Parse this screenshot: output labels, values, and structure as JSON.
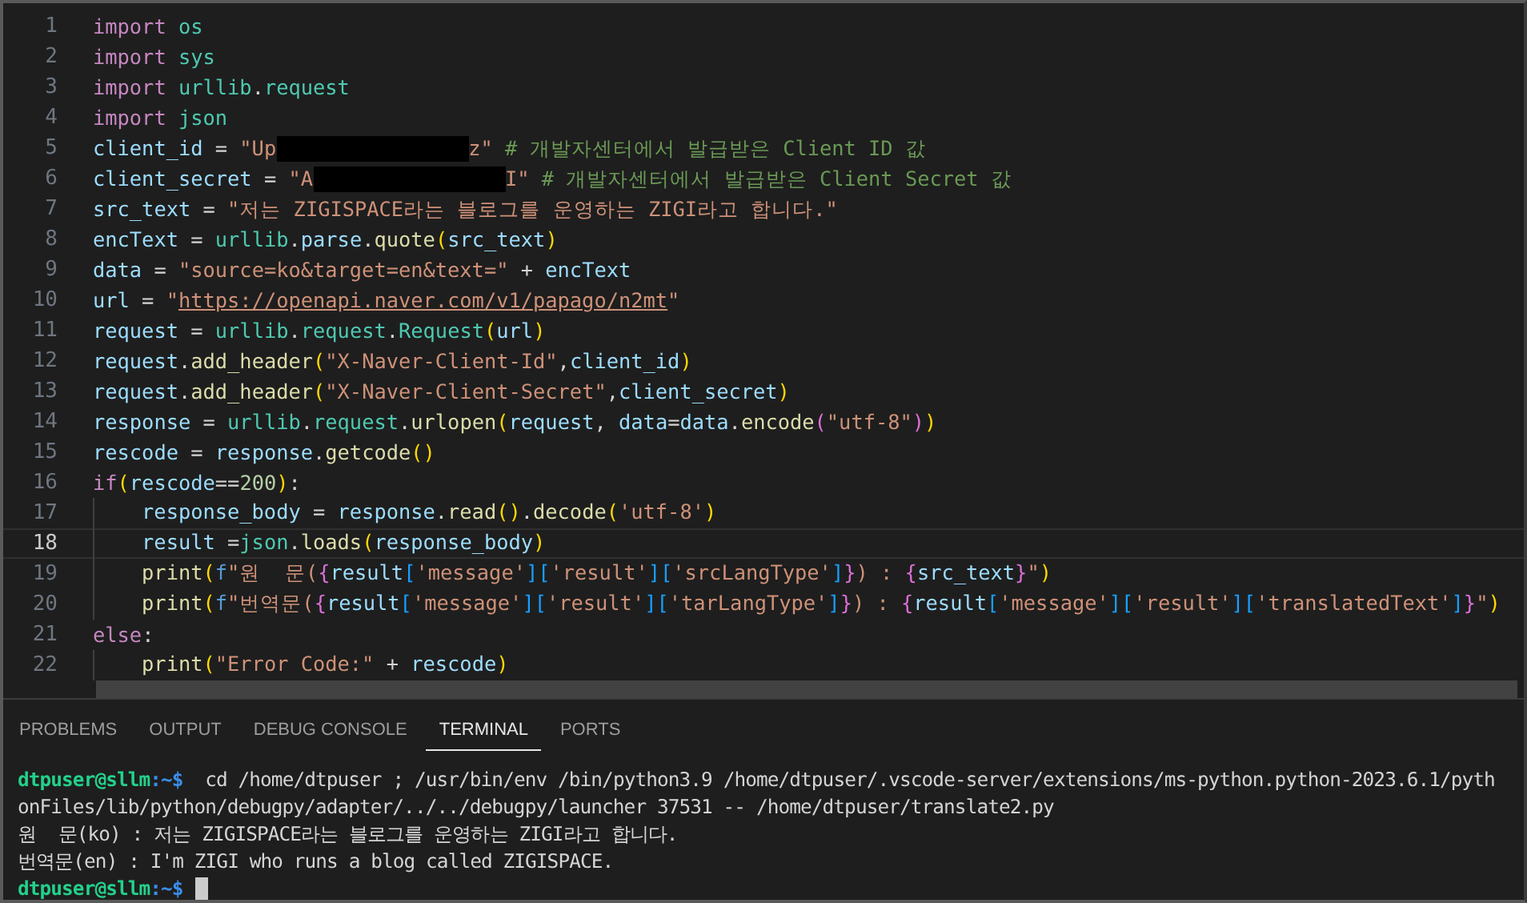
{
  "editor": {
    "lines": [
      {
        "number": "1",
        "current": false,
        "tokens": [
          {
            "kind": "keyword",
            "text": "import"
          },
          {
            "kind": "module",
            "text": " os"
          }
        ]
      },
      {
        "number": "2",
        "current": false,
        "tokens": [
          {
            "kind": "keyword",
            "text": "import"
          },
          {
            "kind": "module",
            "text": " sys"
          }
        ]
      },
      {
        "number": "3",
        "current": false,
        "tokens": [
          {
            "kind": "keyword",
            "text": "import"
          },
          {
            "kind": "module",
            "text": " urllib"
          },
          {
            "kind": "plain",
            "text": "."
          },
          {
            "kind": "module",
            "text": "request"
          }
        ]
      },
      {
        "number": "4",
        "current": false,
        "tokens": [
          {
            "kind": "keyword",
            "text": "import"
          },
          {
            "kind": "module",
            "text": " json"
          }
        ]
      },
      {
        "number": "5",
        "current": false,
        "tokens": [
          {
            "kind": "variable",
            "text": "client_id"
          },
          {
            "kind": "plain",
            "text": " = "
          },
          {
            "kind": "string",
            "text": "\"Up"
          },
          {
            "kind": "redacted"
          },
          {
            "kind": "string",
            "text": "z\""
          },
          {
            "kind": "comment",
            "text": " # 개발자센터에서 발급받은 Client ID 값"
          }
        ]
      },
      {
        "number": "6",
        "current": false,
        "tokens": [
          {
            "kind": "variable",
            "text": "client_secret"
          },
          {
            "kind": "plain",
            "text": " = "
          },
          {
            "kind": "string",
            "text": "\"A"
          },
          {
            "kind": "redacted"
          },
          {
            "kind": "string",
            "text": "I\""
          },
          {
            "kind": "comment",
            "text": " # 개발자센터에서 발급받은 Client Secret 값"
          }
        ]
      },
      {
        "number": "7",
        "current": false,
        "tokens": [
          {
            "kind": "variable",
            "text": "src_text"
          },
          {
            "kind": "plain",
            "text": " = "
          },
          {
            "kind": "string",
            "text": "\"저는 ZIGISPACE라는 블로그를 운영하는 ZIGI라고 합니다.\""
          }
        ]
      },
      {
        "number": "8",
        "current": false,
        "tokens": [
          {
            "kind": "variable",
            "text": "encText"
          },
          {
            "kind": "plain",
            "text": " = "
          },
          {
            "kind": "module",
            "text": "urllib"
          },
          {
            "kind": "plain",
            "text": "."
          },
          {
            "kind": "variable",
            "text": "parse"
          },
          {
            "kind": "plain",
            "text": "."
          },
          {
            "kind": "function",
            "text": "quote"
          },
          {
            "kind": "paren",
            "text": "("
          },
          {
            "kind": "variable",
            "text": "src_text"
          },
          {
            "kind": "paren",
            "text": ")"
          }
        ]
      },
      {
        "number": "9",
        "current": false,
        "tokens": [
          {
            "kind": "variable",
            "text": "data"
          },
          {
            "kind": "plain",
            "text": " = "
          },
          {
            "kind": "string",
            "text": "\"source=ko&target=en&text=\""
          },
          {
            "kind": "plain",
            "text": " + "
          },
          {
            "kind": "variable",
            "text": "encText"
          }
        ]
      },
      {
        "number": "10",
        "current": false,
        "tokens": [
          {
            "kind": "variable",
            "text": "url"
          },
          {
            "kind": "plain",
            "text": " = "
          },
          {
            "kind": "string",
            "text": "\""
          },
          {
            "kind": "link",
            "text": "https://openapi.naver.com/v1/papago/n2mt"
          },
          {
            "kind": "string",
            "text": "\""
          }
        ]
      },
      {
        "number": "11",
        "current": false,
        "tokens": [
          {
            "kind": "variable",
            "text": "request"
          },
          {
            "kind": "plain",
            "text": " = "
          },
          {
            "kind": "module",
            "text": "urllib"
          },
          {
            "kind": "plain",
            "text": "."
          },
          {
            "kind": "module",
            "text": "request"
          },
          {
            "kind": "plain",
            "text": "."
          },
          {
            "kind": "module",
            "text": "Request"
          },
          {
            "kind": "paren",
            "text": "("
          },
          {
            "kind": "variable",
            "text": "url"
          },
          {
            "kind": "paren",
            "text": ")"
          }
        ]
      },
      {
        "number": "12",
        "current": false,
        "tokens": [
          {
            "kind": "variable",
            "text": "request"
          },
          {
            "kind": "plain",
            "text": "."
          },
          {
            "kind": "function",
            "text": "add_header"
          },
          {
            "kind": "paren",
            "text": "("
          },
          {
            "kind": "string",
            "text": "\"X-Naver-Client-Id\""
          },
          {
            "kind": "plain",
            "text": ","
          },
          {
            "kind": "variable",
            "text": "client_id"
          },
          {
            "kind": "paren",
            "text": ")"
          }
        ]
      },
      {
        "number": "13",
        "current": false,
        "tokens": [
          {
            "kind": "variable",
            "text": "request"
          },
          {
            "kind": "plain",
            "text": "."
          },
          {
            "kind": "function",
            "text": "add_header"
          },
          {
            "kind": "paren",
            "text": "("
          },
          {
            "kind": "string",
            "text": "\"X-Naver-Client-Secret\""
          },
          {
            "kind": "plain",
            "text": ","
          },
          {
            "kind": "variable",
            "text": "client_secret"
          },
          {
            "kind": "paren",
            "text": ")"
          }
        ]
      },
      {
        "number": "14",
        "current": false,
        "tokens": [
          {
            "kind": "variable",
            "text": "response"
          },
          {
            "kind": "plain",
            "text": " = "
          },
          {
            "kind": "module",
            "text": "urllib"
          },
          {
            "kind": "plain",
            "text": "."
          },
          {
            "kind": "module",
            "text": "request"
          },
          {
            "kind": "plain",
            "text": "."
          },
          {
            "kind": "function",
            "text": "urlopen"
          },
          {
            "kind": "paren",
            "text": "("
          },
          {
            "kind": "variable",
            "text": "request"
          },
          {
            "kind": "plain",
            "text": ", "
          },
          {
            "kind": "variable",
            "text": "data"
          },
          {
            "kind": "plain",
            "text": "="
          },
          {
            "kind": "variable",
            "text": "data"
          },
          {
            "kind": "plain",
            "text": "."
          },
          {
            "kind": "function",
            "text": "encode"
          },
          {
            "kind": "brace",
            "text": "("
          },
          {
            "kind": "string",
            "text": "\"utf-8\""
          },
          {
            "kind": "brace",
            "text": ")"
          },
          {
            "kind": "paren",
            "text": ")"
          }
        ]
      },
      {
        "number": "15",
        "current": false,
        "tokens": [
          {
            "kind": "variable",
            "text": "rescode"
          },
          {
            "kind": "plain",
            "text": " = "
          },
          {
            "kind": "variable",
            "text": "response"
          },
          {
            "kind": "plain",
            "text": "."
          },
          {
            "kind": "function",
            "text": "getcode"
          },
          {
            "kind": "paren",
            "text": "()"
          }
        ]
      },
      {
        "number": "16",
        "current": false,
        "tokens": [
          {
            "kind": "keyword",
            "text": "if"
          },
          {
            "kind": "paren",
            "text": "("
          },
          {
            "kind": "variable",
            "text": "rescode"
          },
          {
            "kind": "plain",
            "text": "=="
          },
          {
            "kind": "number",
            "text": "200"
          },
          {
            "kind": "paren",
            "text": ")"
          },
          {
            "kind": "plain",
            "text": ":"
          }
        ]
      },
      {
        "number": "17",
        "current": false,
        "tokens": [
          {
            "kind": "indent"
          },
          {
            "kind": "variable",
            "text": "response_body"
          },
          {
            "kind": "plain",
            "text": " = "
          },
          {
            "kind": "variable",
            "text": "response"
          },
          {
            "kind": "plain",
            "text": "."
          },
          {
            "kind": "function",
            "text": "read"
          },
          {
            "kind": "paren",
            "text": "()"
          },
          {
            "kind": "plain",
            "text": "."
          },
          {
            "kind": "function",
            "text": "decode"
          },
          {
            "kind": "paren",
            "text": "("
          },
          {
            "kind": "string",
            "text": "'utf-8'"
          },
          {
            "kind": "paren",
            "text": ")"
          }
        ]
      },
      {
        "number": "18",
        "current": true,
        "tokens": [
          {
            "kind": "indent"
          },
          {
            "kind": "variable",
            "text": "result"
          },
          {
            "kind": "plain",
            "text": " ="
          },
          {
            "kind": "module",
            "text": "json"
          },
          {
            "kind": "plain",
            "text": "."
          },
          {
            "kind": "function",
            "text": "loads"
          },
          {
            "kind": "paren",
            "text": "("
          },
          {
            "kind": "variable",
            "text": "response_body"
          },
          {
            "kind": "paren",
            "text": ")"
          }
        ]
      },
      {
        "number": "19",
        "current": false,
        "tokens": [
          {
            "kind": "indent"
          },
          {
            "kind": "function",
            "text": "print"
          },
          {
            "kind": "paren",
            "text": "("
          },
          {
            "kind": "prefix",
            "text": "f"
          },
          {
            "kind": "string",
            "text": "\"원  문("
          },
          {
            "kind": "brace",
            "text": "{"
          },
          {
            "kind": "variable",
            "text": "result"
          },
          {
            "kind": "bracket",
            "text": "["
          },
          {
            "kind": "string",
            "text": "'message'"
          },
          {
            "kind": "bracket",
            "text": "]["
          },
          {
            "kind": "string",
            "text": "'result'"
          },
          {
            "kind": "bracket",
            "text": "]["
          },
          {
            "kind": "string",
            "text": "'srcLangType'"
          },
          {
            "kind": "bracket",
            "text": "]"
          },
          {
            "kind": "brace",
            "text": "}"
          },
          {
            "kind": "string",
            "text": ") : "
          },
          {
            "kind": "brace",
            "text": "{"
          },
          {
            "kind": "variable",
            "text": "src_text"
          },
          {
            "kind": "brace",
            "text": "}"
          },
          {
            "kind": "string",
            "text": "\""
          },
          {
            "kind": "paren",
            "text": ")"
          }
        ]
      },
      {
        "number": "20",
        "current": false,
        "tokens": [
          {
            "kind": "indent"
          },
          {
            "kind": "function",
            "text": "print"
          },
          {
            "kind": "paren",
            "text": "("
          },
          {
            "kind": "prefix",
            "text": "f"
          },
          {
            "kind": "string",
            "text": "\"번역문("
          },
          {
            "kind": "brace",
            "text": "{"
          },
          {
            "kind": "variable",
            "text": "result"
          },
          {
            "kind": "bracket",
            "text": "["
          },
          {
            "kind": "string",
            "text": "'message'"
          },
          {
            "kind": "bracket",
            "text": "]["
          },
          {
            "kind": "string",
            "text": "'result'"
          },
          {
            "kind": "bracket",
            "text": "]["
          },
          {
            "kind": "string",
            "text": "'tarLangType'"
          },
          {
            "kind": "bracket",
            "text": "]"
          },
          {
            "kind": "brace",
            "text": "}"
          },
          {
            "kind": "string",
            "text": ") : "
          },
          {
            "kind": "brace",
            "text": "{"
          },
          {
            "kind": "variable",
            "text": "result"
          },
          {
            "kind": "bracket",
            "text": "["
          },
          {
            "kind": "string",
            "text": "'message'"
          },
          {
            "kind": "bracket",
            "text": "]["
          },
          {
            "kind": "string",
            "text": "'result'"
          },
          {
            "kind": "bracket",
            "text": "]["
          },
          {
            "kind": "string",
            "text": "'translatedText'"
          },
          {
            "kind": "bracket",
            "text": "]"
          },
          {
            "kind": "brace",
            "text": "}"
          },
          {
            "kind": "string",
            "text": "\""
          },
          {
            "kind": "paren",
            "text": ")"
          }
        ]
      },
      {
        "number": "21",
        "current": false,
        "tokens": [
          {
            "kind": "keyword",
            "text": "else"
          },
          {
            "kind": "plain",
            "text": ":"
          }
        ]
      },
      {
        "number": "22",
        "current": false,
        "tokens": [
          {
            "kind": "indent"
          },
          {
            "kind": "function",
            "text": "print"
          },
          {
            "kind": "paren",
            "text": "("
          },
          {
            "kind": "string",
            "text": "\"Error Code:\""
          },
          {
            "kind": "plain",
            "text": " + "
          },
          {
            "kind": "variable",
            "text": "rescode"
          },
          {
            "kind": "paren",
            "text": ")"
          }
        ]
      }
    ]
  },
  "panel": {
    "tabs": [
      {
        "label": "PROBLEMS",
        "selected": false
      },
      {
        "label": "OUTPUT",
        "selected": false
      },
      {
        "label": "DEBUG CONSOLE",
        "selected": false
      },
      {
        "label": "TERMINAL",
        "selected": true
      },
      {
        "label": "PORTS",
        "selected": false
      }
    ],
    "terminal_lines": [
      {
        "tokens": [
          {
            "kind": "user",
            "text": "dtpuser@sllm"
          },
          {
            "kind": "path",
            "text": ":~$"
          },
          {
            "kind": "plain",
            "text": "  cd /home/dtpuser ; /usr/bin/env /bin/python3.9 /home/dtpuser/.vscode-server/extensions/ms-python.python-2023.6.1/pyth"
          }
        ]
      },
      {
        "tokens": [
          {
            "kind": "plain",
            "text": "onFiles/lib/python/debugpy/adapter/../../debugpy/launcher 37531 -- /home/dtpuser/translate2.py"
          }
        ]
      },
      {
        "tokens": [
          {
            "kind": "plain",
            "text": "원  문(ko) : 저는 ZIGISPACE라는 블로그를 운영하는 ZIGI라고 합니다."
          }
        ]
      },
      {
        "tokens": [
          {
            "kind": "plain",
            "text": "번역문(en) : I'm ZIGI who runs a blog called ZIGISPACE."
          }
        ]
      },
      {
        "tokens": [
          {
            "kind": "user",
            "text": "dtpuser@sllm"
          },
          {
            "kind": "path",
            "text": ":~$"
          },
          {
            "kind": "cursor"
          }
        ]
      }
    ]
  }
}
